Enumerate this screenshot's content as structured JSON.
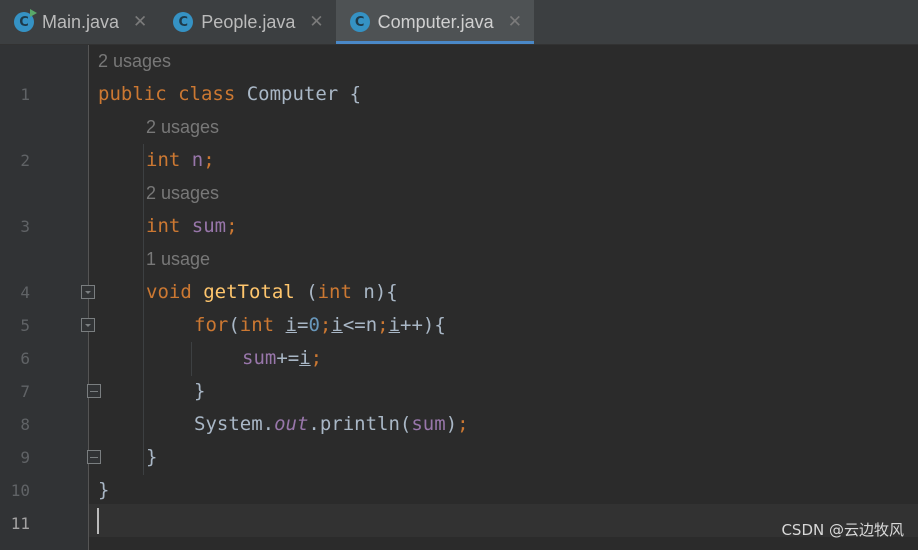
{
  "tabs": [
    {
      "label": "Main.java",
      "icon": "java-class-run-icon",
      "active": false
    },
    {
      "label": "People.java",
      "icon": "java-class-icon",
      "active": false
    },
    {
      "label": "Computer.java",
      "icon": "java-class-icon",
      "active": true
    }
  ],
  "class_icon_letter": "C",
  "close_glyph": "✕",
  "hints": {
    "h1": "2 usages",
    "h2": "2 usages",
    "h3": "2 usages",
    "h4": "1 usage"
  },
  "line_numbers": [
    "1",
    "2",
    "3",
    "4",
    "5",
    "6",
    "7",
    "8",
    "9",
    "10",
    "11"
  ],
  "code": {
    "l1_kw": "public class ",
    "l1_name": "Computer {",
    "l2_kw": "int ",
    "l2_field": "n",
    "l2_semi": ";",
    "l3_kw": "int ",
    "l3_field": "sum",
    "l3_semi": ";",
    "l4_kw": "void ",
    "l4_fn": "getTotal",
    "l4_open": " (",
    "l4_kw2": "int",
    "l4_rest": " n){",
    "l5_kw": "for",
    "l5_p1": "(",
    "l5_kw2": "int ",
    "l5_i1": "i",
    "l5_eq": "=",
    "l5_zero": "0",
    "l5_s1": ";",
    "l5_i2": "i",
    "l5_cmp": "<=n",
    "l5_s2": ";",
    "l5_i3": "i",
    "l5_end": "++){",
    "l6_field": "sum",
    "l6_op": "+=",
    "l6_i": "i",
    "l6_semi": ";",
    "l7": "}",
    "l8_sys": "System.",
    "l8_out": "out",
    "l8_print": ".println(",
    "l8_sum": "sum",
    "l8_close": ")",
    "l8_semi": ";",
    "l9": "}",
    "l10": "}"
  },
  "watermark": "CSDN @云边牧风",
  "colors": {
    "keyword": "#cc7832",
    "field": "#9876aa",
    "method": "#ffc66d",
    "number": "#6897bb",
    "text": "#a9b7c6",
    "hint": "#787878",
    "background": "#2b2b2b",
    "tab_accent": "#4a88c7"
  }
}
